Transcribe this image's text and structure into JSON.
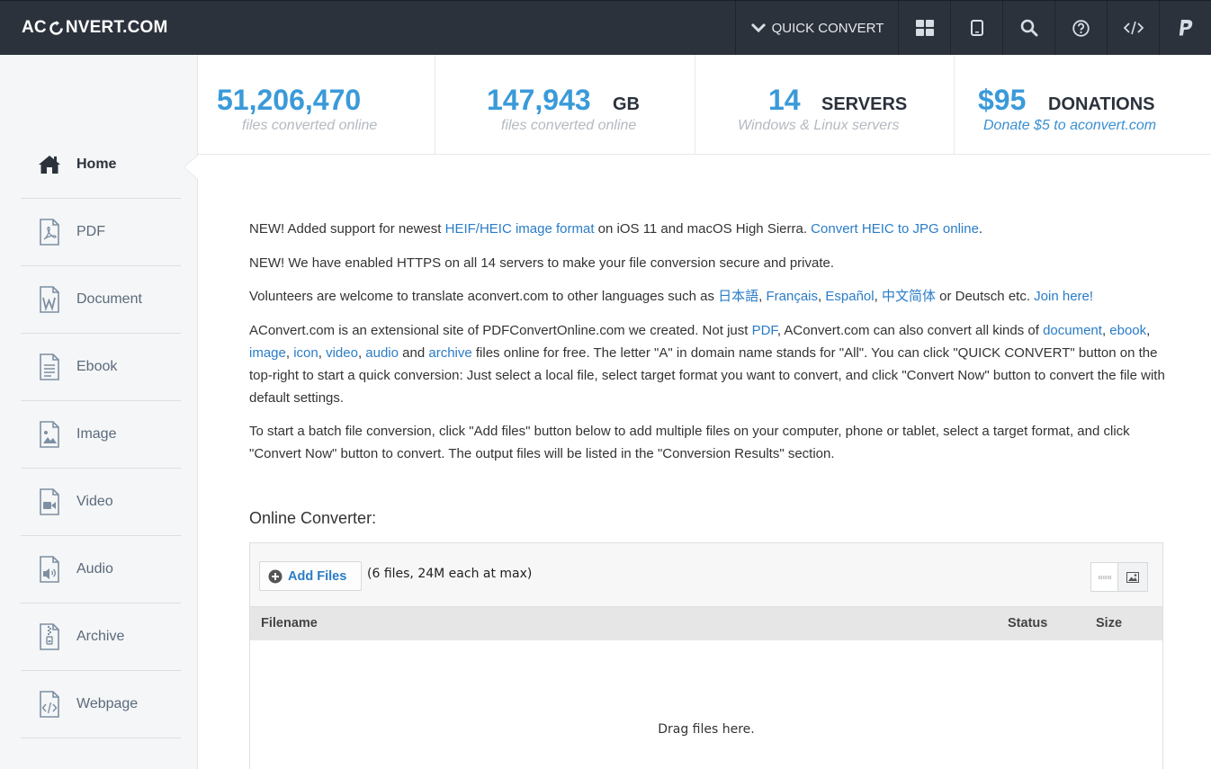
{
  "header": {
    "logo": {
      "part1": "AC",
      "part2": "NVERT.COM"
    },
    "quick_convert_label": "QUICK CONVERT",
    "nav_icons": [
      "grid-icon",
      "tablet-icon",
      "search-icon",
      "help-icon",
      "code-icon",
      "paypal-icon"
    ]
  },
  "sidebar": {
    "items": [
      {
        "label": "Home",
        "icon": "home-icon",
        "active": true
      },
      {
        "label": "PDF",
        "icon": "pdf-file-icon"
      },
      {
        "label": "Document",
        "icon": "word-file-icon"
      },
      {
        "label": "Ebook",
        "icon": "ebook-file-icon"
      },
      {
        "label": "Image",
        "icon": "image-file-icon"
      },
      {
        "label": "Video",
        "icon": "video-file-icon"
      },
      {
        "label": "Audio",
        "icon": "audio-file-icon"
      },
      {
        "label": "Archive",
        "icon": "archive-file-icon"
      },
      {
        "label": "Webpage",
        "icon": "webpage-file-icon"
      }
    ]
  },
  "stats": [
    {
      "number": "51,206,470",
      "unit": "",
      "sub": "files converted online"
    },
    {
      "number": "147,943",
      "unit": "GB",
      "sub": "files converted online"
    },
    {
      "number": "14",
      "unit": "SERVERS",
      "sub": "Windows & Linux servers"
    },
    {
      "number": "$95",
      "unit": "DONATIONS",
      "sub": "Donate $5 to aconvert.com"
    }
  ],
  "content": {
    "p1": {
      "t1": "NEW! Added support for newest ",
      "l1": "HEIF/HEIC image format",
      "t2": " on iOS 11 and macOS High Sierra. ",
      "l2": "Convert HEIC to JPG online",
      "t3": "."
    },
    "p2": "NEW! We have enabled HTTPS on all 14 servers to make your file conversion secure and private.",
    "p3": {
      "t1": "Volunteers are welcome to translate aconvert.com to other languages such as ",
      "l1": "日本語",
      "s1": ", ",
      "l2": "Français",
      "s2": ", ",
      "l3": "Español",
      "s3": ", ",
      "l4": "中文简体",
      "t2": " or Deutsch etc. ",
      "l5": "Join here!"
    },
    "p4": {
      "t1": "AConvert.com is an extensional site of PDFConvertOnline.com we created. Not just ",
      "l1": "PDF",
      "t2": ", AConvert.com can also convert all kinds of ",
      "l2": "document",
      "s1": ", ",
      "l3": "ebook",
      "s2": ", ",
      "l4": "image",
      "s3": ", ",
      "l5": "icon",
      "s4": ", ",
      "l6": "video",
      "s5": ", ",
      "l7": "audio",
      "t3": " and ",
      "l8": "archive",
      "t4": " files online for free. The letter \"A\" in domain name stands for \"All\". You can click \"QUICK CONVERT\" button on the top-right to start a quick conversion: Just select a local file, select target format you want to convert, and click \"Convert Now\" button to convert the file with default settings."
    },
    "p5": "To start a batch file conversion, click \"Add files\" button below to add multiple files on your computer, phone or tablet, select a target format, and click \"Convert Now\" button to convert. The output files will be listed in the \"Conversion Results\" section."
  },
  "converter": {
    "title": "Online Converter:",
    "add_files_label": "Add Files",
    "limit_text": "(6 files, 24M each at max)",
    "columns": {
      "filename": "Filename",
      "status": "Status",
      "size": "Size"
    },
    "drag_text": "Drag files here."
  },
  "colors": {
    "accent": "#3a9ad9",
    "topbar": "#2b323c",
    "link": "#2a7cc7"
  }
}
